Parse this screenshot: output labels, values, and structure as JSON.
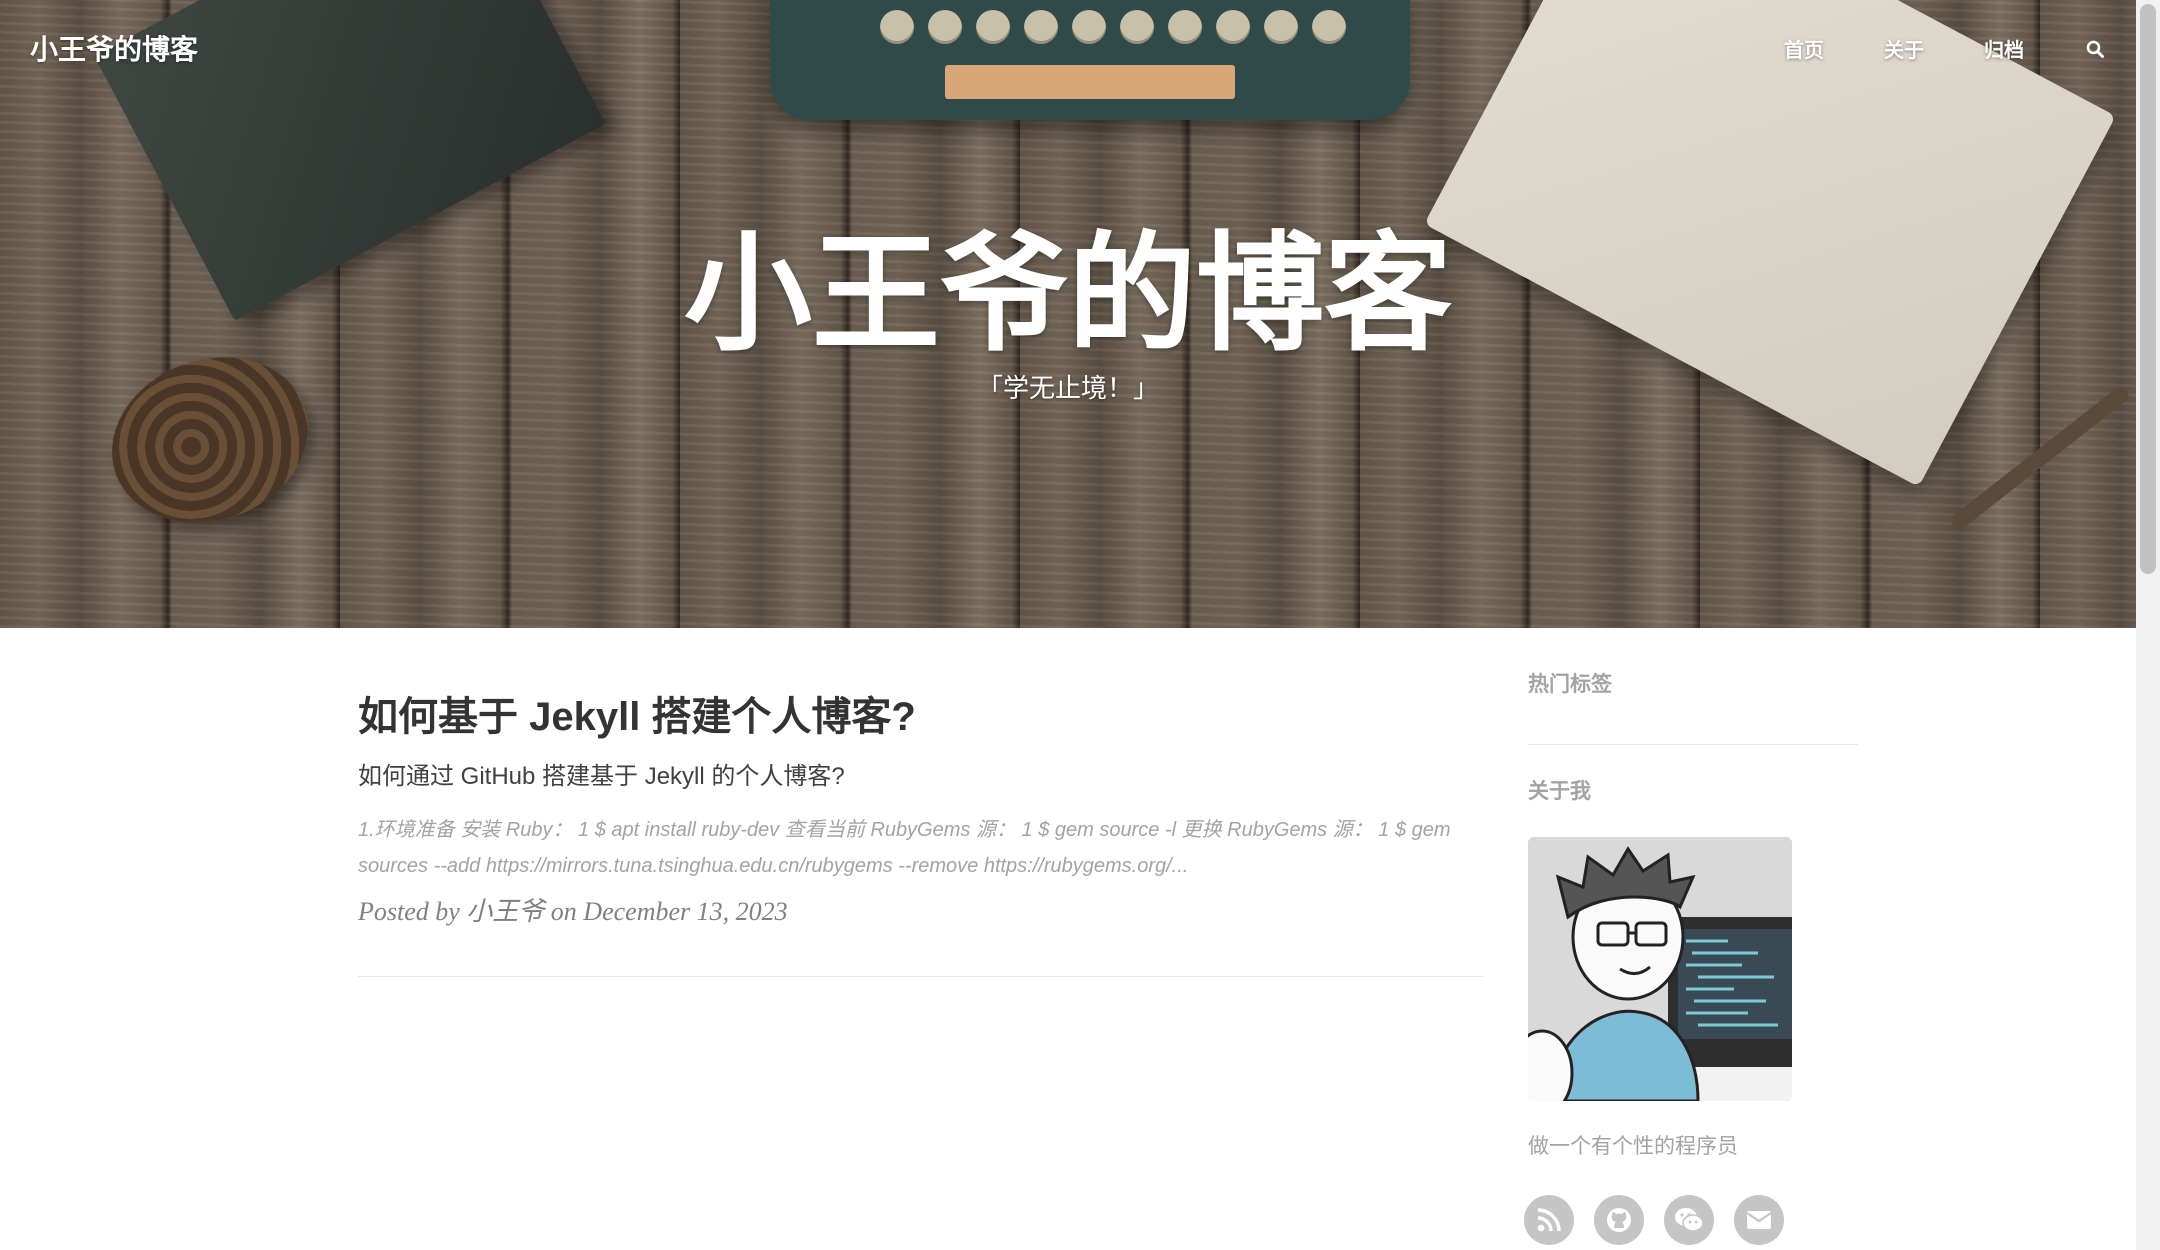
{
  "navbar": {
    "brand": "小王爷的博客",
    "links": [
      {
        "label": "首页"
      },
      {
        "label": "关于"
      },
      {
        "label": "归档"
      }
    ]
  },
  "hero": {
    "title": "小王爷的博客",
    "subtitle": "「学无止境！」"
  },
  "post": {
    "title": "如何基于 Jekyll 搭建个人博客?",
    "subtitle": "如何通过 GitHub 搭建基于 Jekyll 的个人博客?",
    "excerpt": "1.环境准备 安装 Ruby： 1 $ apt install ruby-dev 查看当前 RubyGems 源： 1 $ gem source -l 更换 RubyGems 源： 1 $ gem sources --add https://mirrors.tuna.tsinghua.edu.cn/rubygems --remove https://rubygems.org/...",
    "meta": "Posted by 小王爷 on December 13, 2023"
  },
  "sidebar": {
    "tags_heading": "热门标签",
    "about_heading": "关于我",
    "about_text": "做一个有个性的程序员",
    "social": [
      {
        "icon": "rss-icon"
      },
      {
        "icon": "github-icon"
      },
      {
        "icon": "wechat-icon"
      },
      {
        "icon": "envelope-icon"
      }
    ]
  },
  "colors": {
    "text_dark": "#333333",
    "text_muted": "#a3a3a3",
    "meta": "#808080",
    "social_bg": "#c5c5c5"
  }
}
